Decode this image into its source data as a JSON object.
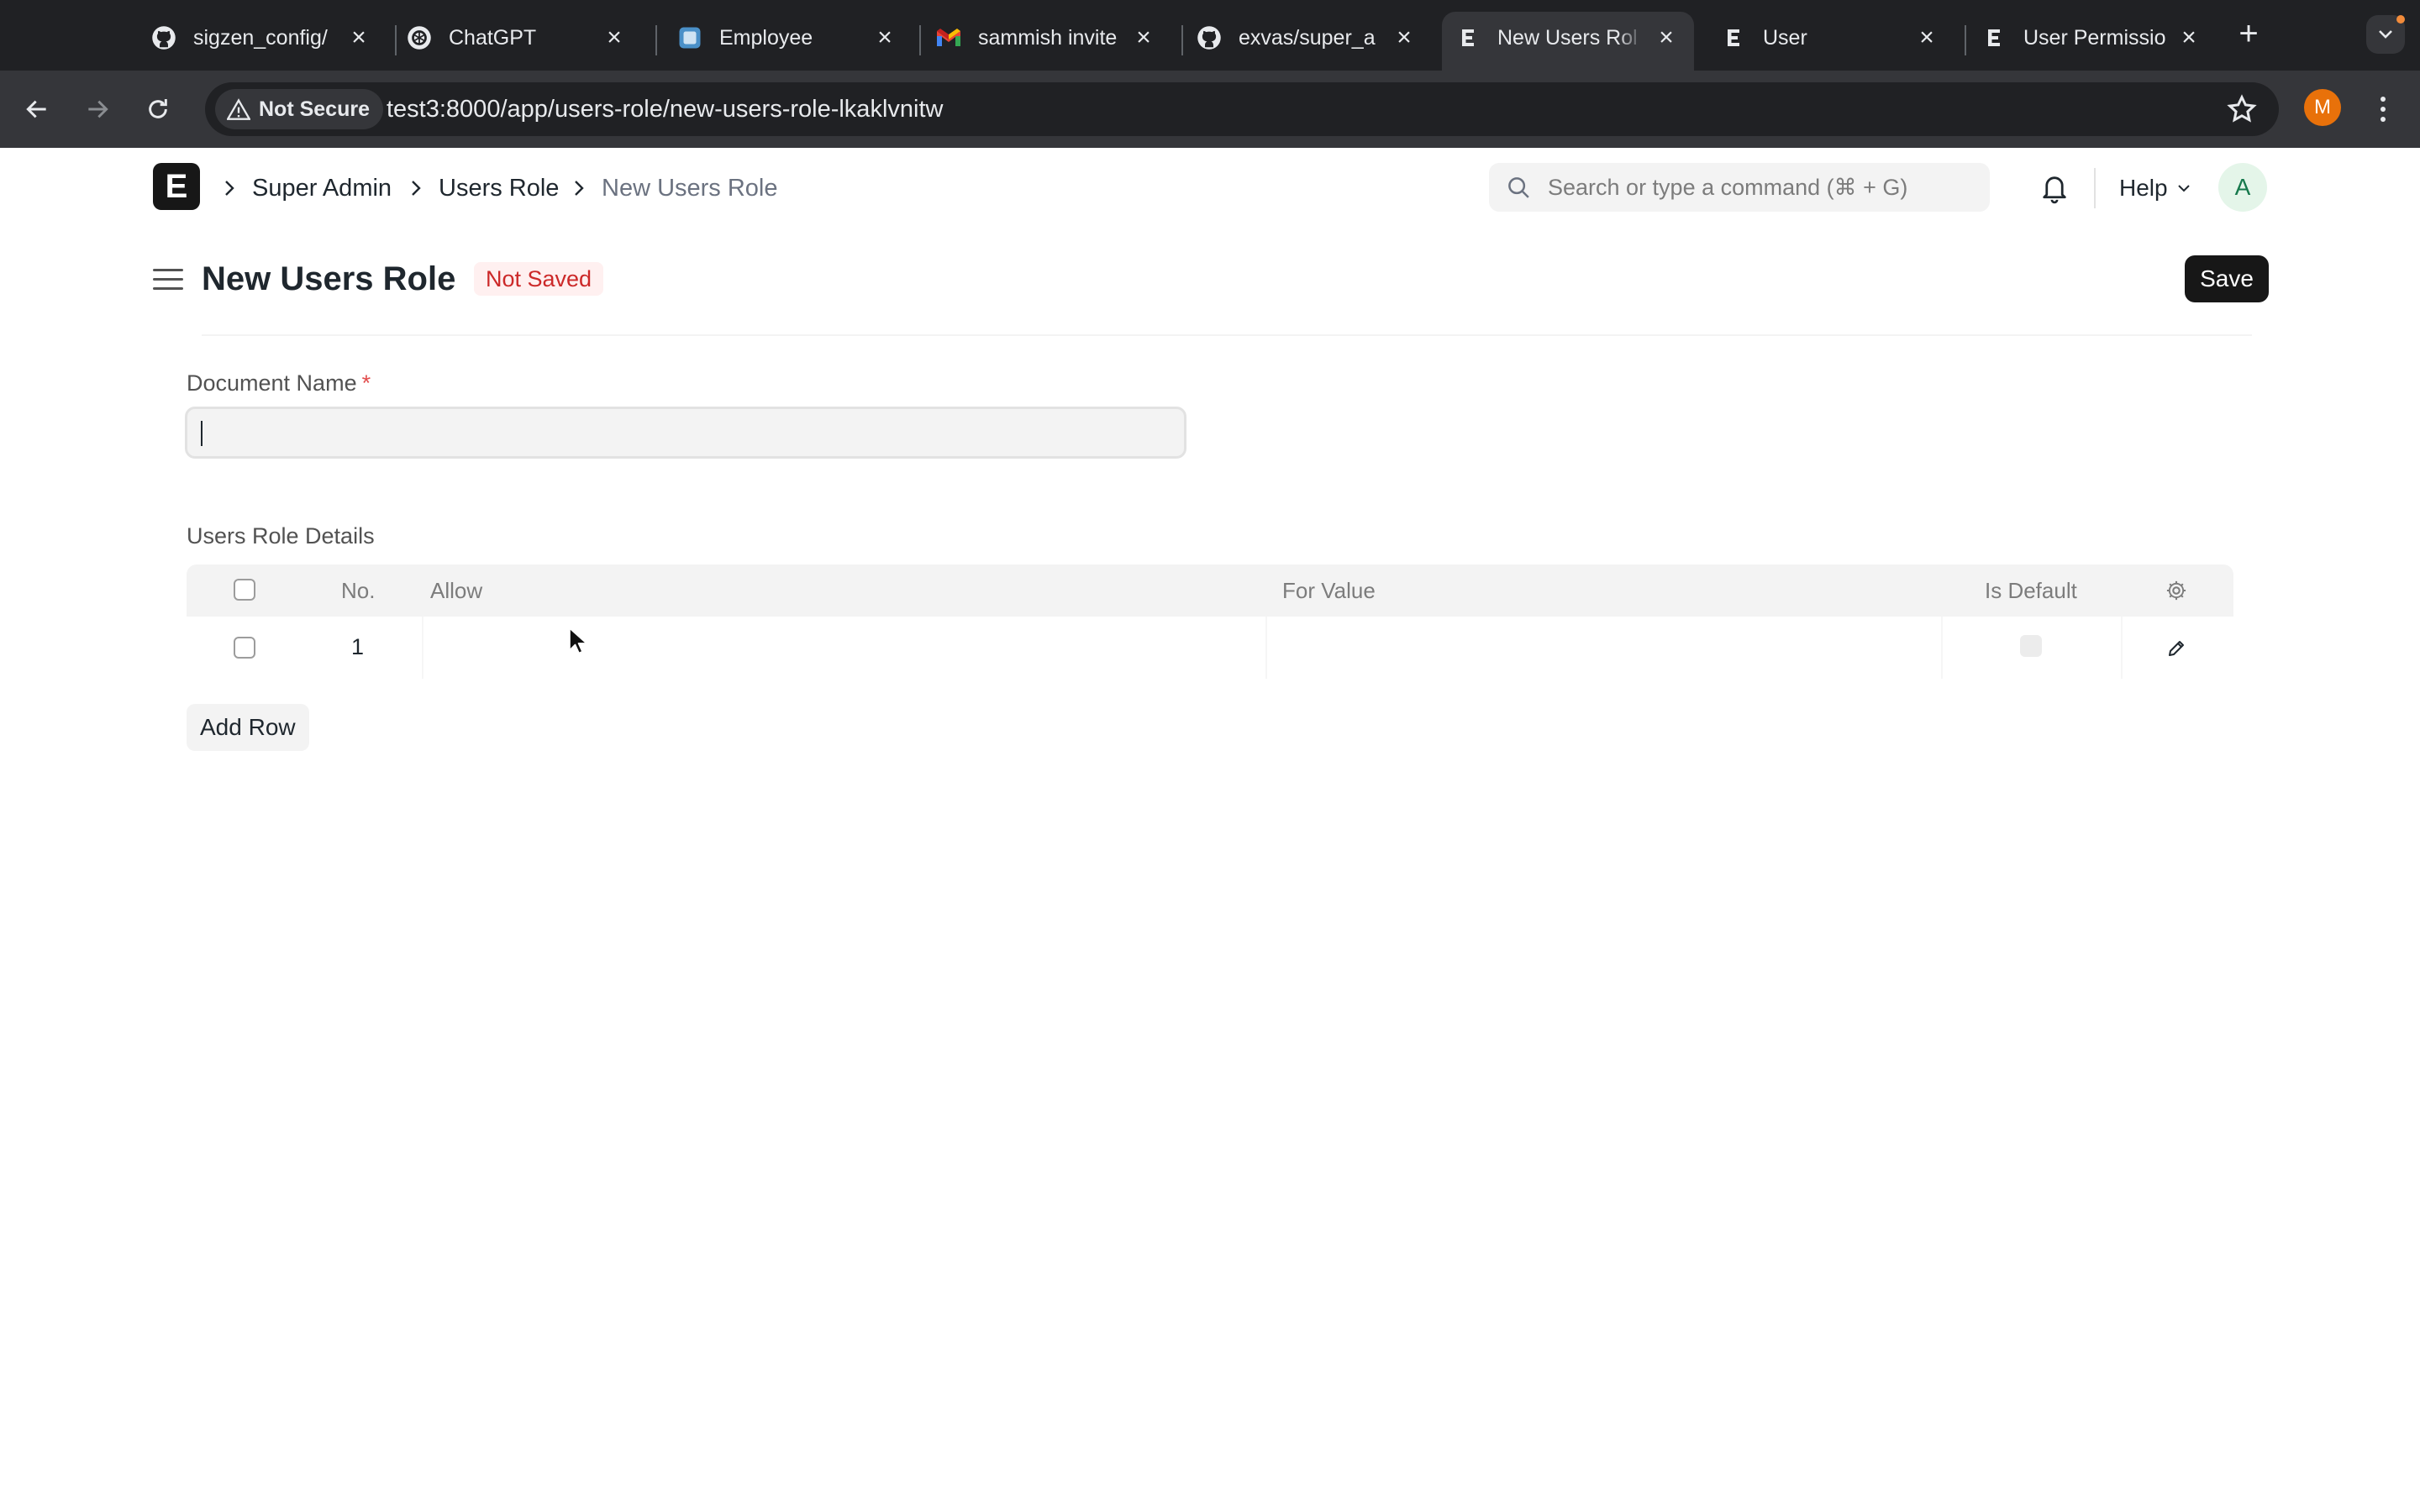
{
  "browser": {
    "tabs": [
      {
        "title": "sigzen_config/",
        "icon": "github-icon",
        "active": false
      },
      {
        "title": "ChatGPT",
        "icon": "chatgpt-icon",
        "active": false
      },
      {
        "title": "Employee",
        "icon": "app-icon",
        "active": false
      },
      {
        "title": "sammish invite",
        "icon": "gmail-icon",
        "active": false
      },
      {
        "title": "exvas/super_a",
        "icon": "github-icon",
        "active": false
      },
      {
        "title": "New Users Rol",
        "icon": "erpnext-icon",
        "active": true
      },
      {
        "title": "User",
        "icon": "erpnext-icon",
        "active": false
      },
      {
        "title": "User Permissio",
        "icon": "erpnext-icon",
        "active": false
      }
    ],
    "security_label": "Not Secure",
    "url": "test3:8000/app/users-role/new-users-role-lkaklvnitw",
    "profile_initial": "M"
  },
  "navbar": {
    "logo_letter": "E",
    "breadcrumbs": [
      "Super Admin",
      "Users Role",
      "New Users Role"
    ],
    "search_placeholder": "Search or type a command (⌘ + G)",
    "help_label": "Help",
    "user_initial": "A"
  },
  "page": {
    "title": "New Users Role",
    "status": "Not Saved",
    "save_label": "Save"
  },
  "form": {
    "document_name_label": "Document Name",
    "required_mark": "*",
    "document_name_value": "",
    "table_label": "Users Role Details",
    "columns": {
      "no": "No.",
      "allow": "Allow",
      "for_value": "For Value",
      "is_default": "Is Default"
    },
    "rows": [
      {
        "no": "1",
        "allow": "",
        "for_value": "",
        "is_default": false
      }
    ],
    "add_row_label": "Add Row"
  },
  "colors": {
    "chrome_dark": "#202124",
    "chrome_toolbar": "#35363a",
    "status_red": "#cc2929",
    "primary_button": "#171717",
    "avatar_green": "#16794c"
  }
}
